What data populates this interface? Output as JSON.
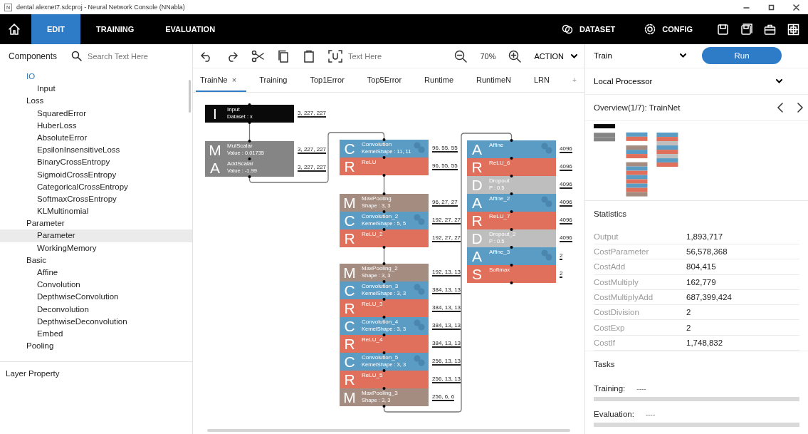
{
  "title_bar": {
    "app_icon": "N",
    "title": "dental alexnet7.sdcproj - Neural Network Console (NNabla)"
  },
  "nav": {
    "tabs": [
      {
        "label": "EDIT",
        "selected": true
      },
      {
        "label": "TRAINING",
        "selected": false
      },
      {
        "label": "EVALUATION",
        "selected": false
      }
    ],
    "right_items": [
      {
        "kind": "dataset",
        "label": "DATASET"
      },
      {
        "kind": "config",
        "label": "CONFIG"
      }
    ]
  },
  "sidebar": {
    "title": "Components",
    "search": {
      "placeholder": "Search Text Here"
    },
    "items": [
      {
        "label": "IO",
        "active": true,
        "selected": false,
        "children": [
          {
            "label": "Input",
            "selected": false
          }
        ]
      },
      {
        "label": "Loss",
        "active": false,
        "selected": false,
        "children": [
          {
            "label": "SquaredError",
            "selected": false
          },
          {
            "label": "HuberLoss",
            "selected": false
          },
          {
            "label": "AbsoluteError",
            "selected": false
          },
          {
            "label": "EpsilonInsensitiveLoss",
            "selected": false
          },
          {
            "label": "BinaryCrossEntropy",
            "selected": false
          },
          {
            "label": "SigmoidCrossEntropy",
            "selected": false
          },
          {
            "label": "CategoricalCrossEntropy",
            "selected": false
          },
          {
            "label": "SoftmaxCrossEntropy",
            "selected": false
          },
          {
            "label": "KLMultinomial",
            "selected": false
          }
        ]
      },
      {
        "label": "Parameter",
        "active": false,
        "selected": false,
        "children": [
          {
            "label": "Parameter",
            "selected": true
          },
          {
            "label": "WorkingMemory",
            "selected": false
          }
        ]
      },
      {
        "label": "Basic",
        "active": false,
        "selected": false,
        "children": [
          {
            "label": "Affine",
            "selected": false
          },
          {
            "label": "Convolution",
            "selected": false
          },
          {
            "label": "DepthwiseConvolution",
            "selected": false
          },
          {
            "label": "Deconvolution",
            "selected": false
          },
          {
            "label": "DepthwiseDeconvolution",
            "selected": false
          },
          {
            "label": "Embed",
            "selected": false
          }
        ]
      },
      {
        "label": "Pooling",
        "active": false,
        "selected": false
      }
    ],
    "footer": "Layer Property"
  },
  "toolbar": {
    "text_field": {
      "placeholder": "Text Here"
    },
    "zoom": "70%",
    "action": "ACTION"
  },
  "tabs": [
    {
      "label": "TrainNe",
      "selected": true,
      "close": "×"
    },
    {
      "label": "Training",
      "selected": false
    },
    {
      "label": "Top1Error",
      "selected": false
    },
    {
      "label": "Top5Error",
      "selected": false
    },
    {
      "label": "Runtime",
      "selected": false
    },
    {
      "label": "RuntimeN",
      "selected": false
    },
    {
      "label": "LRN",
      "selected": false
    }
  ],
  "add_tab": "+",
  "network": {
    "groups": [
      {
        "layers": [
          {
            "kind": "input",
            "letter": "I",
            "name": "Input",
            "detail": "Dataset : x",
            "shape": "3, 227, 227"
          }
        ]
      },
      {
        "layers": [
          {
            "kind": "scalar",
            "letter": "M",
            "name": "MulScalar",
            "detail": "Value : 0.01735",
            "shape": "3, 227, 227"
          },
          {
            "kind": "scalar",
            "letter": "A",
            "name": "AddScalar",
            "detail": "Value : -1.99",
            "shape": "3, 227, 227"
          }
        ]
      },
      {
        "layers": [
          {
            "kind": "convolution",
            "letter": "C",
            "name": "Convolution",
            "detail": "KernelShape : 11, 11",
            "shape": "96, 55, 55"
          },
          {
            "kind": "activation",
            "letter": "R",
            "name": "ReLU",
            "shape": "96, 55, 55"
          }
        ]
      },
      {
        "layers": [
          {
            "kind": "pooling",
            "letter": "M",
            "name": "MaxPooling",
            "detail": "Shape : 3, 3",
            "shape": "96, 27, 27"
          },
          {
            "kind": "convolution",
            "letter": "C",
            "name": "Convolution_2",
            "detail": "KernelShape : 5, 5",
            "shape": "192, 27, 27"
          },
          {
            "kind": "activation",
            "letter": "R",
            "name": "ReLU_2",
            "shape": "192, 27, 27"
          }
        ]
      },
      {
        "layers": [
          {
            "kind": "pooling",
            "letter": "M",
            "name": "MaxPooling_2",
            "detail": "Shape : 3, 3",
            "shape": "192, 13, 13"
          },
          {
            "kind": "convolution",
            "letter": "C",
            "name": "Convolution_3",
            "detail": "KernelShape : 3, 3",
            "shape": "384, 13, 13"
          },
          {
            "kind": "activation",
            "letter": "R",
            "name": "ReLU_3",
            "shape": "384, 13, 13"
          },
          {
            "kind": "convolution",
            "letter": "C",
            "name": "Convolution_4",
            "detail": "KernelShape : 3, 3",
            "shape": "384, 13, 13"
          },
          {
            "kind": "activation",
            "letter": "R",
            "name": "ReLU_4",
            "shape": "384, 13, 13"
          },
          {
            "kind": "convolution",
            "letter": "C",
            "name": "Convolution_5",
            "detail": "KernelShape : 3, 3",
            "shape": "256, 13, 13"
          },
          {
            "kind": "activation",
            "letter": "R",
            "name": "ReLU_5",
            "shape": "256, 13, 13"
          },
          {
            "kind": "pooling",
            "letter": "M",
            "name": "MaxPooling_3",
            "detail": "Shape : 3, 3",
            "shape": "256, 6, 6"
          }
        ]
      },
      {
        "layers": [
          {
            "kind": "affine",
            "letter": "A",
            "name": "Affine",
            "shape": "4096"
          },
          {
            "kind": "activation",
            "letter": "R",
            "name": "ReLU_6",
            "shape": "4096"
          },
          {
            "kind": "dropout",
            "letter": "D",
            "name": "Dropout",
            "detail": "P : 0.5",
            "shape": "4096"
          },
          {
            "kind": "affine",
            "letter": "A",
            "name": "Affine_2",
            "shape": "4096"
          },
          {
            "kind": "activation",
            "letter": "R",
            "name": "ReLU_7",
            "shape": "4096"
          },
          {
            "kind": "dropout",
            "letter": "D",
            "name": "Dropout_2",
            "detail": "P : 0.5",
            "shape": "4096"
          },
          {
            "kind": "affine",
            "letter": "A",
            "name": "Affine_3",
            "shape": "2"
          },
          {
            "kind": "softmax",
            "letter": "S",
            "name": "Softmax",
            "shape": "2"
          }
        ]
      }
    ]
  },
  "right_panel": {
    "mode": "Train",
    "run_button": "Run",
    "processor": "Local Processor",
    "overview": "Overview(1/7): TrainNet",
    "statistics": {
      "title": "Statistics",
      "rows": [
        {
          "name": "Output",
          "value": "1,893,717"
        },
        {
          "name": "CostParameter",
          "value": "56,578,368"
        },
        {
          "name": "CostAdd",
          "value": "804,415"
        },
        {
          "name": "CostMultiply",
          "value": "162,779"
        },
        {
          "name": "CostMultiplyAdd",
          "value": "687,399,424"
        },
        {
          "name": "CostDivision",
          "value": "2"
        },
        {
          "name": "CostExp",
          "value": "2"
        },
        {
          "name": "CostIf",
          "value": "1,748,832"
        }
      ]
    },
    "tasks": {
      "title": "Tasks",
      "items": [
        {
          "label": "Training:",
          "status": "----",
          "level": 0
        },
        {
          "label": "Evaluation:",
          "status": "----",
          "level": 0
        }
      ]
    }
  }
}
